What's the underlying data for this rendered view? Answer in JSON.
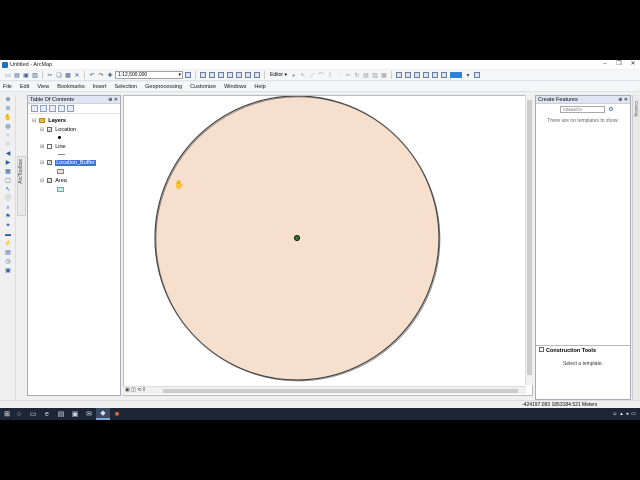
{
  "window": {
    "title": "Untitled - ArcMap"
  },
  "toolbar": {
    "scale_value": "1:12,500,000",
    "editor_label": "Editor ▾"
  },
  "menu": [
    "File",
    "Edit",
    "View",
    "Bookmarks",
    "Insert",
    "Selection",
    "Geoprocessing",
    "Customize",
    "Windows",
    "Help"
  ],
  "side_tab": {
    "label": "ArcToolbox"
  },
  "toc": {
    "title": "Table Of Contents",
    "root": "Layers",
    "layers": [
      {
        "name": "Location",
        "checked": true
      },
      {
        "name": "Line",
        "checked": false
      },
      {
        "name": "Location_Buffer",
        "checked": true,
        "selected": true
      },
      {
        "name": "Area",
        "checked": true
      }
    ]
  },
  "create_features": {
    "title": "Create Features",
    "search_placeholder": "<Search>",
    "empty_message": "There are no templates to show.",
    "construction_title": "Construction Tools",
    "construction_message": "Select a template."
  },
  "right_strip": {
    "label": "Catalog"
  },
  "status": {
    "coordinates": "-424197.093  1853184.521 Meters"
  },
  "colors": {
    "buffer_fill": "#f6dfcd",
    "buffer_stroke": "#444444",
    "point": "#2f7a2f",
    "selection": "#3b74d4"
  }
}
